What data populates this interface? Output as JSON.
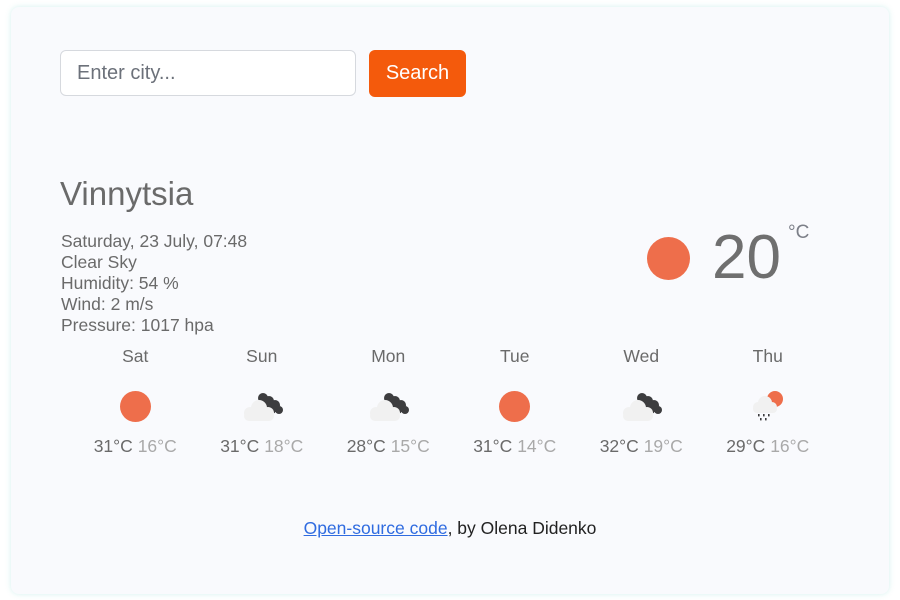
{
  "search": {
    "placeholder": "Enter city...",
    "value": "",
    "button_label": "Search"
  },
  "current": {
    "city": "Vinnytsia",
    "datetime": "Saturday, 23 July, 07:48",
    "description": "Clear Sky",
    "humidity": "Humidity: 54 %",
    "wind": "Wind: 2 m/s",
    "pressure": "Pressure: 1017 hpa",
    "temperature": "20",
    "unit": "°C",
    "icon": "clear-sky-icon"
  },
  "forecast": [
    {
      "day": "Sat",
      "max": "31°C",
      "min": "16°C",
      "icon": "clear-sky-icon"
    },
    {
      "day": "Sun",
      "max": "31°C",
      "min": "18°C",
      "icon": "broken-clouds-icon"
    },
    {
      "day": "Mon",
      "max": "28°C",
      "min": "15°C",
      "icon": "broken-clouds-icon"
    },
    {
      "day": "Tue",
      "max": "31°C",
      "min": "14°C",
      "icon": "clear-sky-icon"
    },
    {
      "day": "Wed",
      "max": "32°C",
      "min": "19°C",
      "icon": "broken-clouds-icon"
    },
    {
      "day": "Thu",
      "max": "29°C",
      "min": "16°C",
      "icon": "rain-sun-icon"
    }
  ],
  "footer": {
    "link_text": "Open-source code",
    "suffix": ", by Olena Didenko"
  },
  "colors": {
    "accent": "#f45a0c",
    "sun": "#ee6e4b",
    "link": "#2f6be0"
  }
}
